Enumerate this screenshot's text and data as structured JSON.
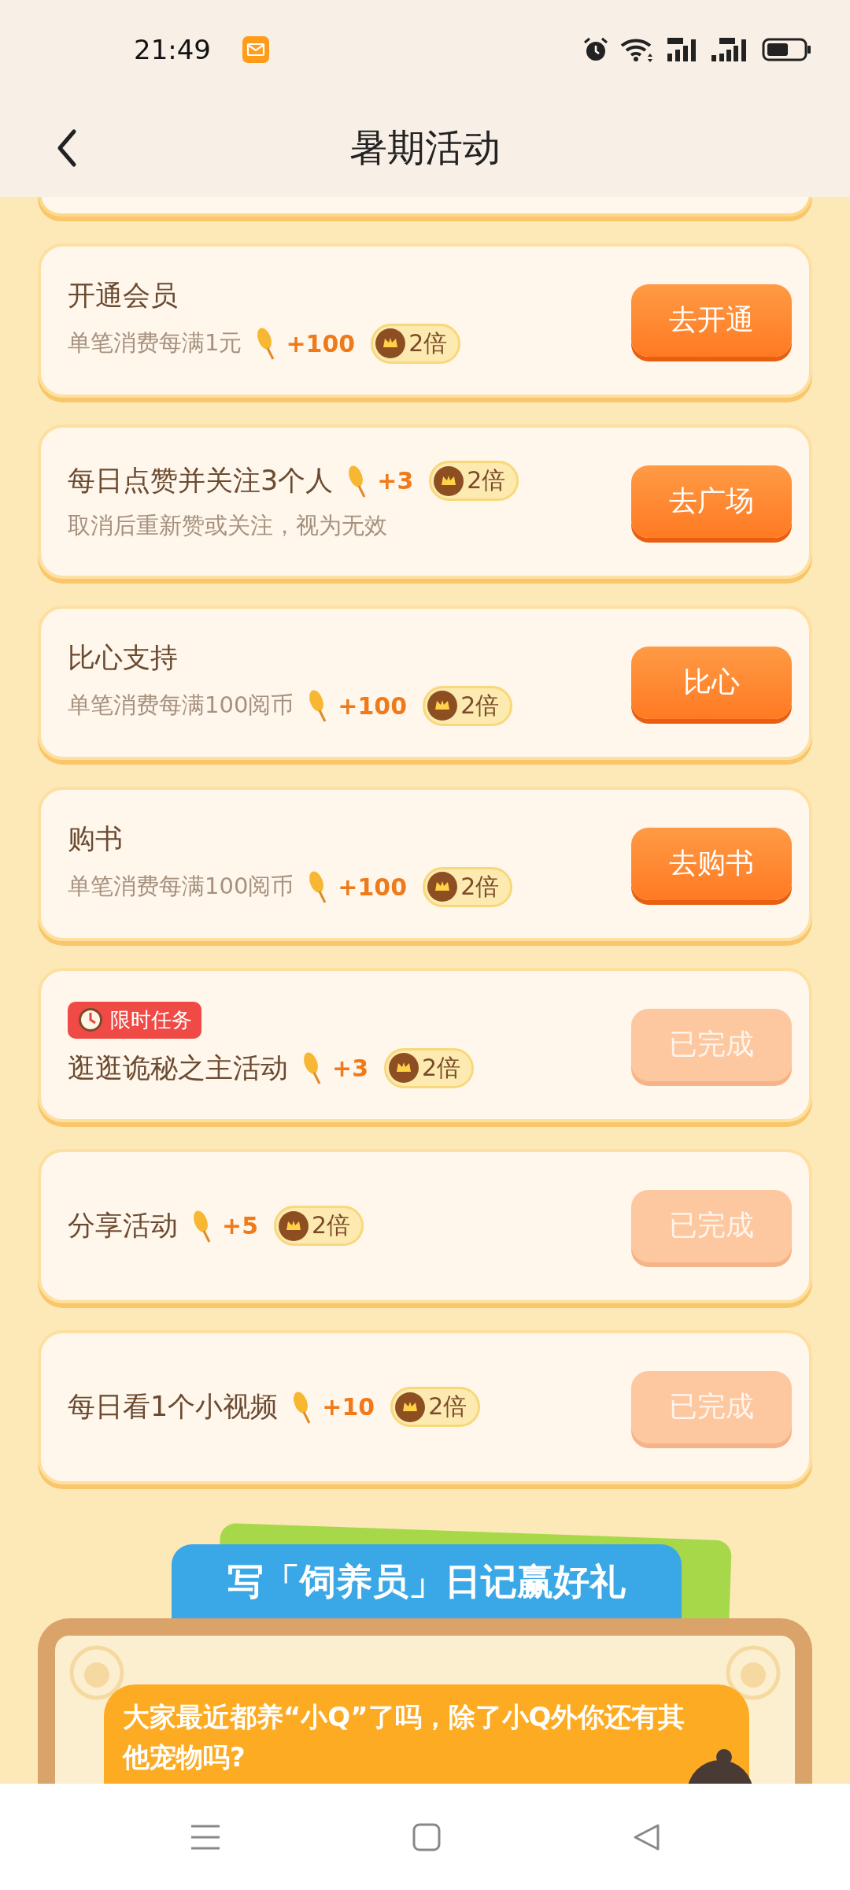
{
  "status_bar": {
    "time": "21:49"
  },
  "header": {
    "title": "暑期活动"
  },
  "tasks": [
    {
      "title": "开通会员",
      "subtitle": "单笔消费每满1元",
      "subtitle_reward": {
        "points": "+100",
        "multiplier": "2倍"
      },
      "button": "去开通",
      "completed": false
    },
    {
      "title": "每日点赞并关注3个人",
      "title_reward": {
        "points": "+3",
        "multiplier": "2倍"
      },
      "subtitle": "取消后重新赞或关注，视为无效",
      "button": "去广场",
      "completed": false
    },
    {
      "title": "比心支持",
      "subtitle": "单笔消费每满100阅币",
      "subtitle_reward": {
        "points": "+100",
        "multiplier": "2倍"
      },
      "button": "比心",
      "completed": false
    },
    {
      "title": "购书",
      "subtitle": "单笔消费每满100阅币",
      "subtitle_reward": {
        "points": "+100",
        "multiplier": "2倍"
      },
      "button": "去购书",
      "completed": false
    },
    {
      "tag": "限时任务",
      "title": "逛逛诡秘之主活动",
      "title_reward": {
        "points": "+3",
        "multiplier": "2倍"
      },
      "button": "已完成",
      "completed": true
    },
    {
      "title": "分享活动",
      "title_reward": {
        "points": "+5",
        "multiplier": "2倍"
      },
      "button": "已完成",
      "completed": true
    },
    {
      "title": "每日看1个小视频",
      "title_reward": {
        "points": "+10",
        "multiplier": "2倍"
      },
      "button": "已完成",
      "completed": true
    }
  ],
  "diary": {
    "banner": "写「饲养员」日记赢好礼",
    "question": "大家最近都养“小Q”了吗，除了小Q外你还有其他宠物吗?"
  }
}
